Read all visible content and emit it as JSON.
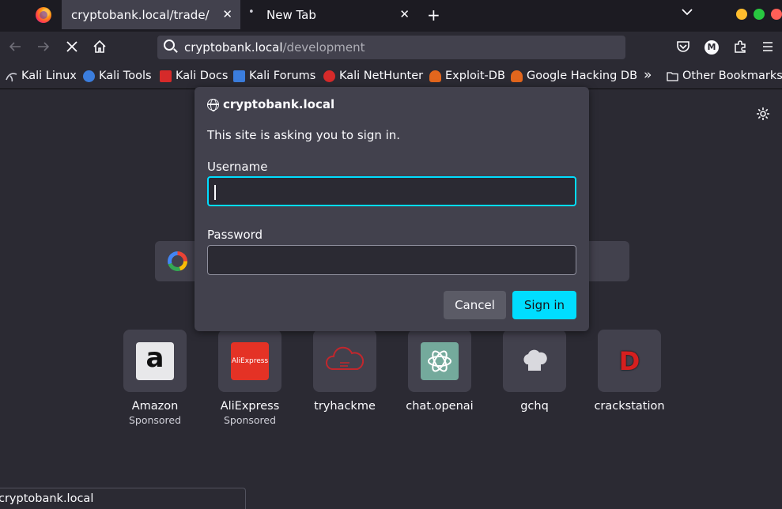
{
  "tabs": [
    {
      "title": "cryptobank.local/trade/",
      "close": "✕"
    },
    {
      "title": "New Tab",
      "close": "✕",
      "dot": "•"
    }
  ],
  "toolbar": {
    "new_tab": "+",
    "list_all_tabs": "⌄",
    "back": "←",
    "forward": "→",
    "stop": "✕",
    "home": "⌂",
    "pocket": "♥",
    "profile_initial": "M",
    "extensions": "⧉",
    "menu": "≡"
  },
  "urlbar": {
    "host": "cryptobank.local",
    "path": "/development"
  },
  "bookmarks": [
    {
      "label": "Kali Linux",
      "icon": "kali-icon",
      "color": "#cfcfd8"
    },
    {
      "label": "Kali Tools",
      "icon": "kali-tools-icon",
      "color": "#3b7ddd"
    },
    {
      "label": "Kali Docs",
      "icon": "kali-docs-icon",
      "color": "#d62a2a"
    },
    {
      "label": "Kali Forums",
      "icon": "kali-forums-icon",
      "color": "#3b7ddd"
    },
    {
      "label": "Kali NetHunter",
      "icon": "kali-nethunter-icon",
      "color": "#d62a2a"
    },
    {
      "label": "Exploit-DB",
      "icon": "exploit-db-icon",
      "color": "#e2661d"
    },
    {
      "label": "Google Hacking DB",
      "icon": "ghdb-icon",
      "color": "#e2661d"
    },
    {
      "label": "Other Bookmarks",
      "icon": "folder-icon",
      "color": "#fbfbfe"
    }
  ],
  "bookmarks_overflow": "»",
  "dialog": {
    "host": "cryptobank.local",
    "message": "This site is asking you to sign in.",
    "username_label": "Username",
    "username_value": "",
    "password_label": "Password",
    "password_value": "",
    "cancel_label": "Cancel",
    "signin_label": "Sign in"
  },
  "top_sites": [
    {
      "label": "Amazon",
      "sub": "Sponsored",
      "thumb_color": "#e8e8ea"
    },
    {
      "label": "AliExpress",
      "sub": "Sponsored",
      "thumb_color": "#e43225"
    },
    {
      "label": "tryhackme",
      "sub": "",
      "thumb_color": "#42414d"
    },
    {
      "label": "chat.openai",
      "sub": "",
      "thumb_color": "#74aa9c"
    },
    {
      "label": "gchq",
      "sub": "",
      "thumb_color": "#42414d"
    },
    {
      "label": "crackstation",
      "sub": "",
      "thumb_color": "#42414d"
    }
  ],
  "thumb_text": {
    "amazon": "a",
    "aliexpress": "AliExpress",
    "crackstation": "D"
  },
  "status": "cryptobank.local",
  "colors": {
    "accent": "#00ddff",
    "background": "#2b2a33",
    "dialog": "#42414d"
  }
}
